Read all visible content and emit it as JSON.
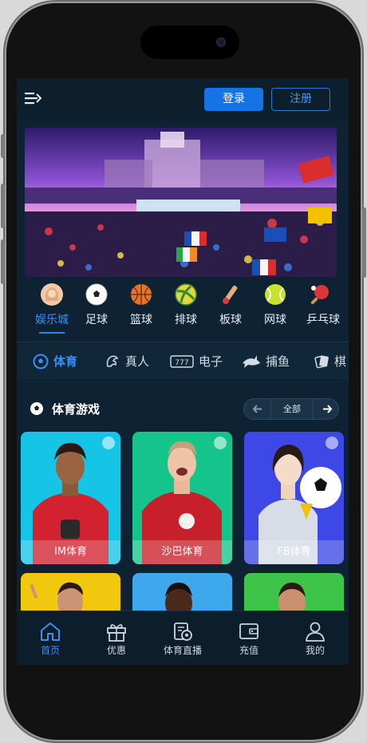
{
  "header": {
    "login_label": "登录",
    "register_label": "注册"
  },
  "sport_categories": [
    {
      "label": "娱乐城",
      "icon": "casino-girl-icon",
      "active": true
    },
    {
      "label": "足球",
      "icon": "soccer-ball-icon"
    },
    {
      "label": "篮球",
      "icon": "basketball-icon"
    },
    {
      "label": "排球",
      "icon": "volleyball-icon"
    },
    {
      "label": "板球",
      "icon": "cricket-icon"
    },
    {
      "label": "网球",
      "icon": "tennis-ball-icon"
    },
    {
      "label": "乒乓球",
      "icon": "ping-pong-icon"
    }
  ],
  "game_tabs": [
    {
      "label": "体育",
      "icon": "soccer-ball-icon",
      "active": true
    },
    {
      "label": "真人",
      "icon": "casino-chip-icon"
    },
    {
      "label": "电子",
      "icon": "slot-777-icon"
    },
    {
      "label": "捕鱼",
      "icon": "shark-icon"
    },
    {
      "label": "棋",
      "icon": "cards-icon"
    }
  ],
  "section": {
    "title": "体育游戏",
    "pager_all": "全部"
  },
  "cards": [
    {
      "label": "IM体育",
      "bg": "#16c4e6"
    },
    {
      "label": "沙巴体育",
      "bg": "#14c48b"
    },
    {
      "label": "FB体育",
      "bg": "#3d48e6"
    }
  ],
  "cards_row2_colors": [
    "#f2c80f",
    "#3ea8ec",
    "#3fc44a"
  ],
  "bottom_nav": [
    {
      "label": "首页",
      "icon": "home-icon",
      "active": true
    },
    {
      "label": "优惠",
      "icon": "gift-icon"
    },
    {
      "label": "体育直播",
      "icon": "sports-live-icon"
    },
    {
      "label": "充值",
      "icon": "wallet-icon"
    },
    {
      "label": "我的",
      "icon": "user-icon"
    }
  ],
  "colors": {
    "accent": "#1673e6",
    "bg": "#0e2233"
  }
}
